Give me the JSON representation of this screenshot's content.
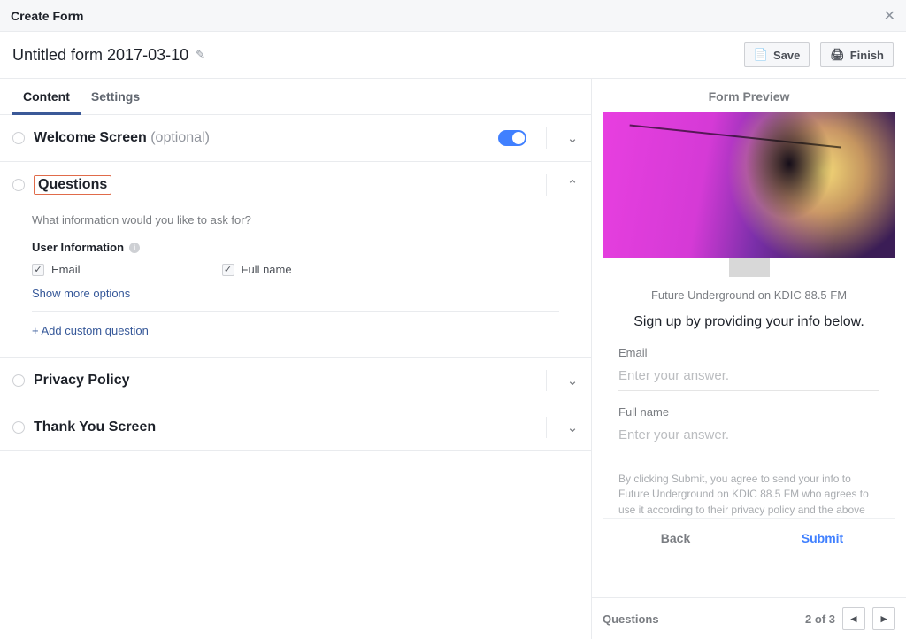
{
  "header": {
    "title": "Create Form"
  },
  "titlebar": {
    "form_name": "Untitled form 2017-03-10",
    "save": "Save",
    "finish": "Finish"
  },
  "tabs": {
    "content": "Content",
    "settings": "Settings"
  },
  "sections": {
    "welcome": {
      "title": "Welcome Screen",
      "optional": "(optional)"
    },
    "questions": {
      "title": "Questions",
      "prompt": "What information would you like to ask for?",
      "user_info": "User Information",
      "email": "Email",
      "full_name": "Full name",
      "show_more": "Show more options",
      "add_custom": "+ Add custom question"
    },
    "privacy": {
      "title": "Privacy Policy"
    },
    "thankyou": {
      "title": "Thank You Screen"
    }
  },
  "preview": {
    "label": "Form Preview",
    "brand": "Future Underground on KDIC 88.5 FM",
    "headline": "Sign up by providing your info below.",
    "fields": {
      "email_label": "Email",
      "email_placeholder": "Enter your answer.",
      "name_label": "Full name",
      "name_placeholder": "Enter your answer."
    },
    "disclaimer": "By clicking Submit, you agree to send your info to Future Underground on KDIC 88.5 FM who agrees to use it according to their privacy policy and the above Terms. Facebook will also use it subject to our",
    "back": "Back",
    "submit": "Submit"
  },
  "pager": {
    "section": "Questions",
    "page_of": "2 of 3"
  }
}
